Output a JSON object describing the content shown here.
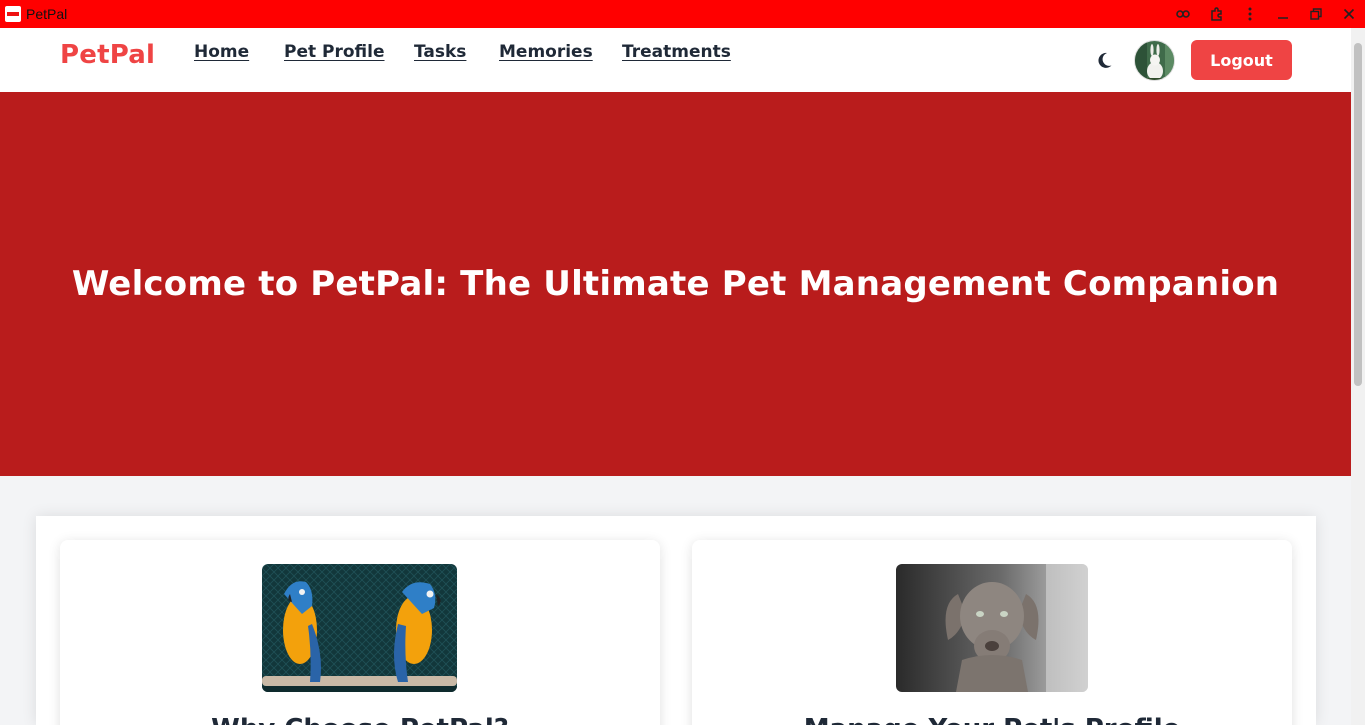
{
  "window": {
    "title": "PetPal",
    "controls": [
      "key-icon",
      "extension-icon",
      "more-vert-icon",
      "minimize-icon",
      "restore-icon",
      "close-icon"
    ]
  },
  "nav": {
    "brand": "PetPal",
    "links": [
      "Home",
      "Pet Profile",
      "Tasks",
      "Memories",
      "Treatments"
    ],
    "theme_toggle_icon": "moon-icon",
    "logout_label": "Logout"
  },
  "hero": {
    "title": "Welcome to PetPal: The Ultimate Pet Management Companion"
  },
  "cards": [
    {
      "title": "Why Choose PetPal?",
      "image": "parrots-image"
    },
    {
      "title": "Manage Your Pet's Profile",
      "image": "dog-image"
    }
  ],
  "colors": {
    "titlebar": "#ff0000",
    "accent": "#ef4444",
    "hero_bg": "#b91c1c",
    "page_bg": "#f3f4f6"
  }
}
